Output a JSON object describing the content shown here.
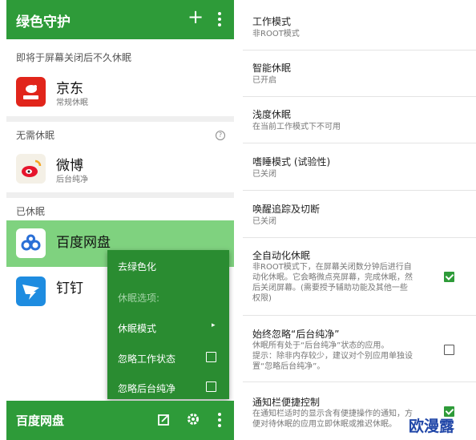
{
  "left": {
    "appbar": {
      "title": "绿色守护",
      "add_icon": "+"
    },
    "sections": {
      "pending": "即将于屏幕关闭后不久休眠",
      "not_needed": "无需休眠",
      "hibernated": "已休眠"
    },
    "apps": {
      "jd": {
        "name": "京东",
        "sub": "常规休眠",
        "icon_text": "京东"
      },
      "weibo": {
        "name": "微博",
        "sub": "后台纯净"
      },
      "baidu": {
        "name": "百度网盘"
      },
      "dingtalk": {
        "name": "钉钉"
      }
    },
    "help_icon": "?",
    "menu": {
      "items": [
        "去绿色化",
        "休眠选项:",
        "休眠模式",
        "忽略工作状态",
        "忽略后台纯净"
      ],
      "submenu_arrow": "▸"
    },
    "bottombar": {
      "title": "百度网盘"
    }
  },
  "right": {
    "settings": [
      {
        "title": "工作模式",
        "sub": "非ROOT模式"
      },
      {
        "title": "智能休眠",
        "sub": "已开启"
      },
      {
        "title": "浅度休眠",
        "sub": "在当前工作模式下不可用"
      },
      {
        "title": "嗜睡模式 (试验性)",
        "sub": "已关闭"
      },
      {
        "title": "唤醒追踪及切断",
        "sub": "已关闭"
      },
      {
        "title": "全自动化休眠",
        "sub": "非ROOT模式下，在屏幕关闭数分钟后进行自\n动化休眠。它会略微点亮屏幕，完成休眠，然\n后关闭屏幕。(需要授予辅助功能及其他一些\n权限)",
        "checked": true
      },
      {
        "title": "始终忽略“后台纯净”",
        "sub": "休眠所有处于“后台纯净”状态的应用。\n提示：除非内存较少，建议对个别应用单独设\n置“忽略后台纯净”。",
        "checked": false
      },
      {
        "title": "通知栏便捷控制",
        "sub": "在通知栏适时的显示含有便捷操作的通知，方\n便对待休眠的应用立即休眠或推迟休眠。",
        "checked": true
      }
    ]
  },
  "watermark": "欧漫露",
  "colors": {
    "primary": "#2e9b39",
    "menu": "#2a8c31",
    "selected_row": "#7fd27f"
  }
}
